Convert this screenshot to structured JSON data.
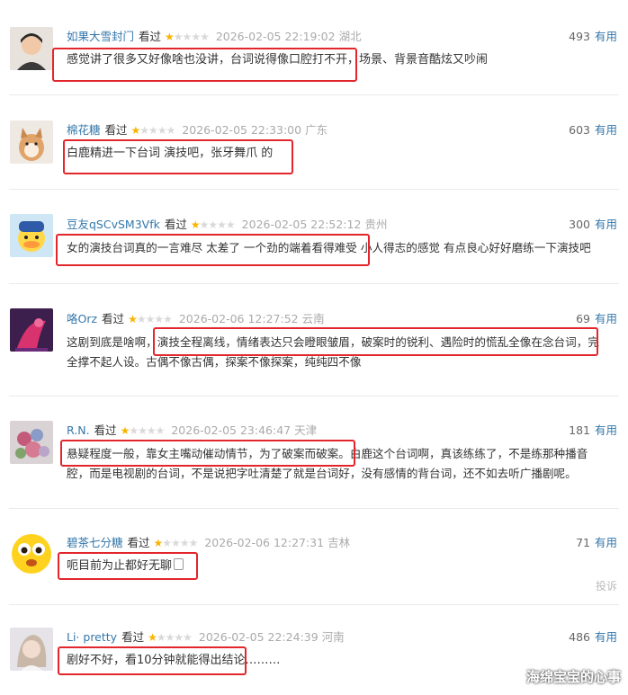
{
  "reviews": [
    {
      "user": "如果大雪封门",
      "status": "看过",
      "time": "2026-02-05 22:19:02",
      "location": "湖北",
      "votes": "493",
      "useful": "有用",
      "lines": [
        "感觉讲了很多又好像啥也没讲，台词说得像口腔打不开，场景、背景音酷炫又吵闹"
      ],
      "rating": 1
    },
    {
      "user": "棉花糖",
      "status": "看过",
      "time": "2026-02-05 22:33:00",
      "location": "广东",
      "votes": "603",
      "useful": "有用",
      "lines": [
        "白鹿精进一下台词 演技吧，张牙舞爪 的"
      ],
      "rating": 1
    },
    {
      "user": "豆友qSCvSM3Vfk",
      "status": "看过",
      "time": "2026-02-05 22:52:12",
      "location": "贵州",
      "votes": "300",
      "useful": "有用",
      "lines": [
        "女的演技台词真的一言难尽 太差了 一个劲的端着看得难受 小人得志的感觉 有点良心好好磨练一下演技吧"
      ],
      "rating": 1
    },
    {
      "user": "咯Orz",
      "status": "看过",
      "time": "2026-02-06 12:27:52",
      "location": "云南",
      "votes": "69",
      "useful": "有用",
      "lines": [
        "这剧到底是啥啊，演技全程离线，情绪表达只会瞪眼皱眉，破案时的锐利、遇险时的慌乱全像在念台词，完",
        "全撑不起人设。古偶不像古偶，探案不像探案，纯纯四不像"
      ],
      "rating": 1
    },
    {
      "user": "R.N.",
      "status": "看过",
      "time": "2026-02-05 23:46:47",
      "location": "天津",
      "votes": "181",
      "useful": "有用",
      "lines": [
        "悬疑程度一般，靠女主嘴动催动情节，为了破案而破案。白鹿这个台词啊，真该练练了，不是练那种播音",
        "腔，而是电视剧的台词，不是说把字吐清楚了就是台词好，没有感情的背台词，还不如去听广播剧呢。"
      ],
      "rating": 1
    },
    {
      "user": "碧茶七分糖",
      "status": "看过",
      "time": "2026-02-06 12:27:31",
      "location": "吉林",
      "votes": "71",
      "useful": "有用",
      "lines": [
        "呃目前为止都好无聊"
      ],
      "rating": 1,
      "report": "投诉"
    },
    {
      "user": "Li· pretty",
      "status": "看过",
      "time": "2026-02-05 22:24:39",
      "location": "河南",
      "votes": "486",
      "useful": "有用",
      "lines": [
        "剧好不好，看10分钟就能得出结论………"
      ],
      "rating": 1
    }
  ],
  "watermark": "海绵宝宝的心事",
  "colors": {
    "link": "#3377aa",
    "star": "#f7b500",
    "highlight": "#e2262c"
  },
  "icons": [
    "star-icon",
    "emoji-icon"
  ]
}
